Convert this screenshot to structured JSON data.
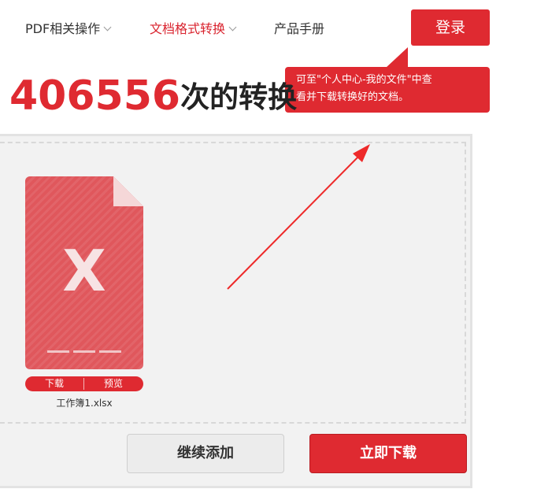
{
  "nav": {
    "items": [
      {
        "label": "PDF相关操作"
      },
      {
        "label": "文档格式转换"
      },
      {
        "label": "产品手册"
      }
    ],
    "login_label": "登录"
  },
  "tooltip": {
    "line1": "可至\"个人中心-我的文件\"中查",
    "line2": "看并下载转换好的文档。"
  },
  "headline": {
    "count": "406556",
    "suffix": "次的转换"
  },
  "file": {
    "letter": "X",
    "download_label": "下载",
    "preview_label": "预览",
    "name": "工作簿1.xlsx"
  },
  "actions": {
    "continue_label": "继续添加",
    "download_now_label": "立即下载"
  },
  "colors": {
    "accent": "#df2a31",
    "file_icon": "#e0575c"
  }
}
